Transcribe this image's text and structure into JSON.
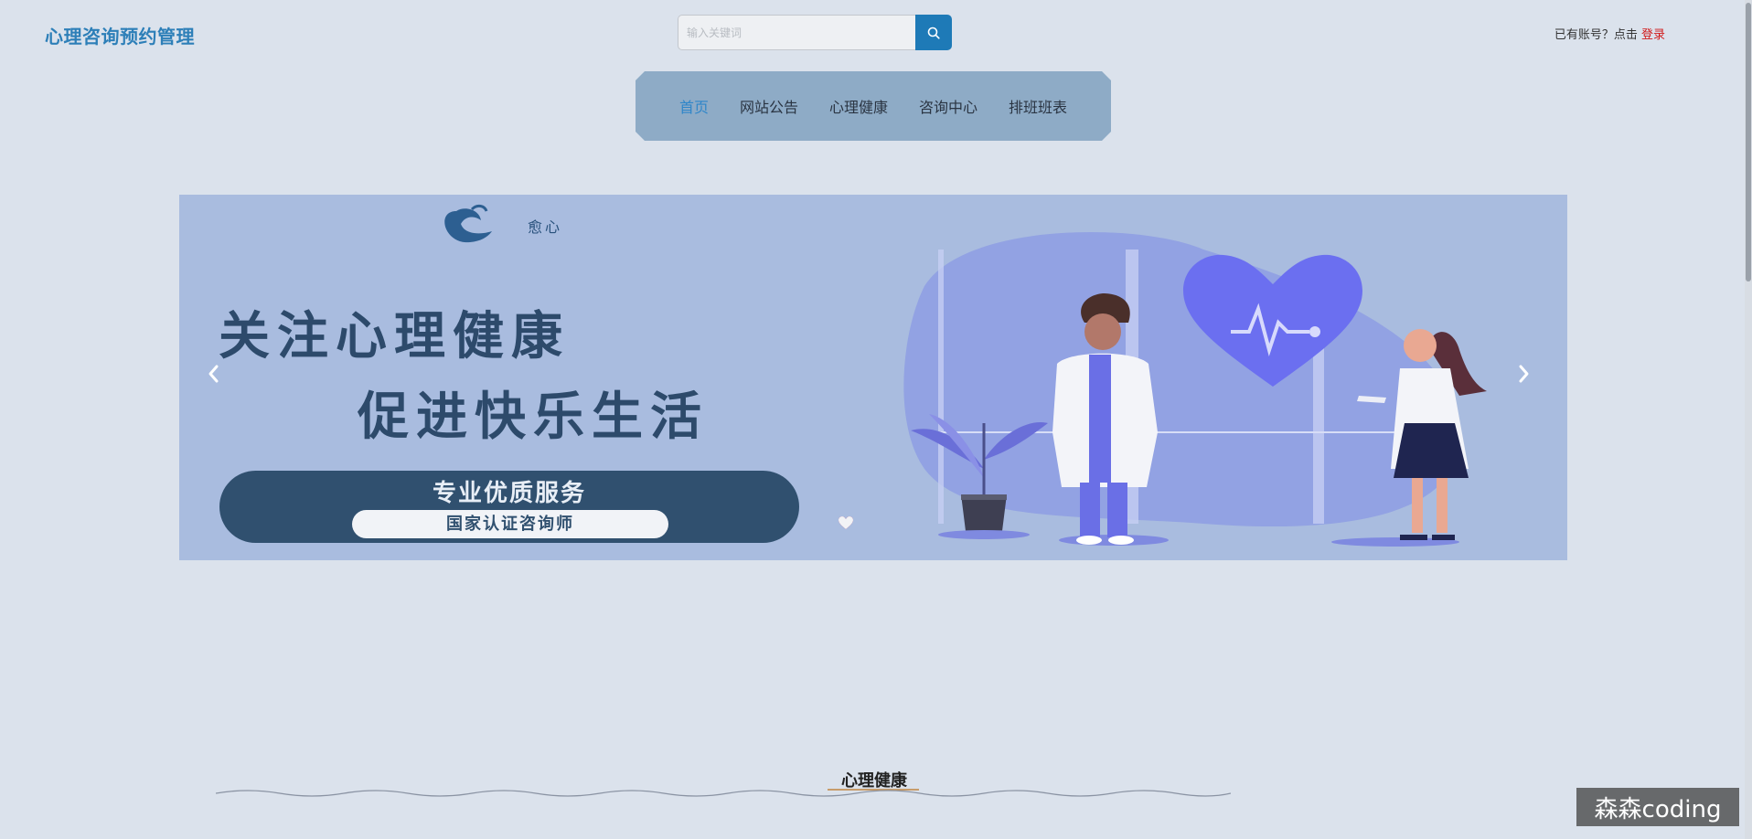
{
  "header": {
    "brand": "心理咨询预约管理",
    "search": {
      "placeholder": "输入关键词",
      "value": ""
    },
    "login_prompt": "已有账号？点击",
    "login_link": "登录"
  },
  "nav": {
    "items": [
      {
        "label": "首页",
        "active": true
      },
      {
        "label": "网站公告",
        "active": false
      },
      {
        "label": "心理健康",
        "active": false
      },
      {
        "label": "咨询中心",
        "active": false
      },
      {
        "label": "排班班表",
        "active": false
      }
    ]
  },
  "banner": {
    "logo_text": "愈心",
    "headline_line1": "关注心理健康",
    "headline_line2": "促进快乐生活",
    "pill_title": "专业优质服务",
    "pill_subtitle": "国家认证咨询师",
    "dots": [
      {
        "icon": "heart-icon",
        "color": "#9b3d73"
      },
      {
        "icon": "heart-icon",
        "color": "#9b3d73"
      },
      {
        "icon": "heart-icon",
        "color": "#f2f3f6"
      }
    ],
    "prev_icon": "chevron-left-icon",
    "next_icon": "chevron-right-icon"
  },
  "section": {
    "title": "心理健康"
  },
  "watermark": "森森coding",
  "colors": {
    "brand": "#2d7fb8",
    "search_button": "#1e7ab7",
    "login_link": "#d11a1a",
    "nav_bg": "#8eabc6",
    "nav_active": "#2f86c9",
    "page_bg": "#dbe2ec",
    "banner_bg": "#a9bcdf"
  }
}
